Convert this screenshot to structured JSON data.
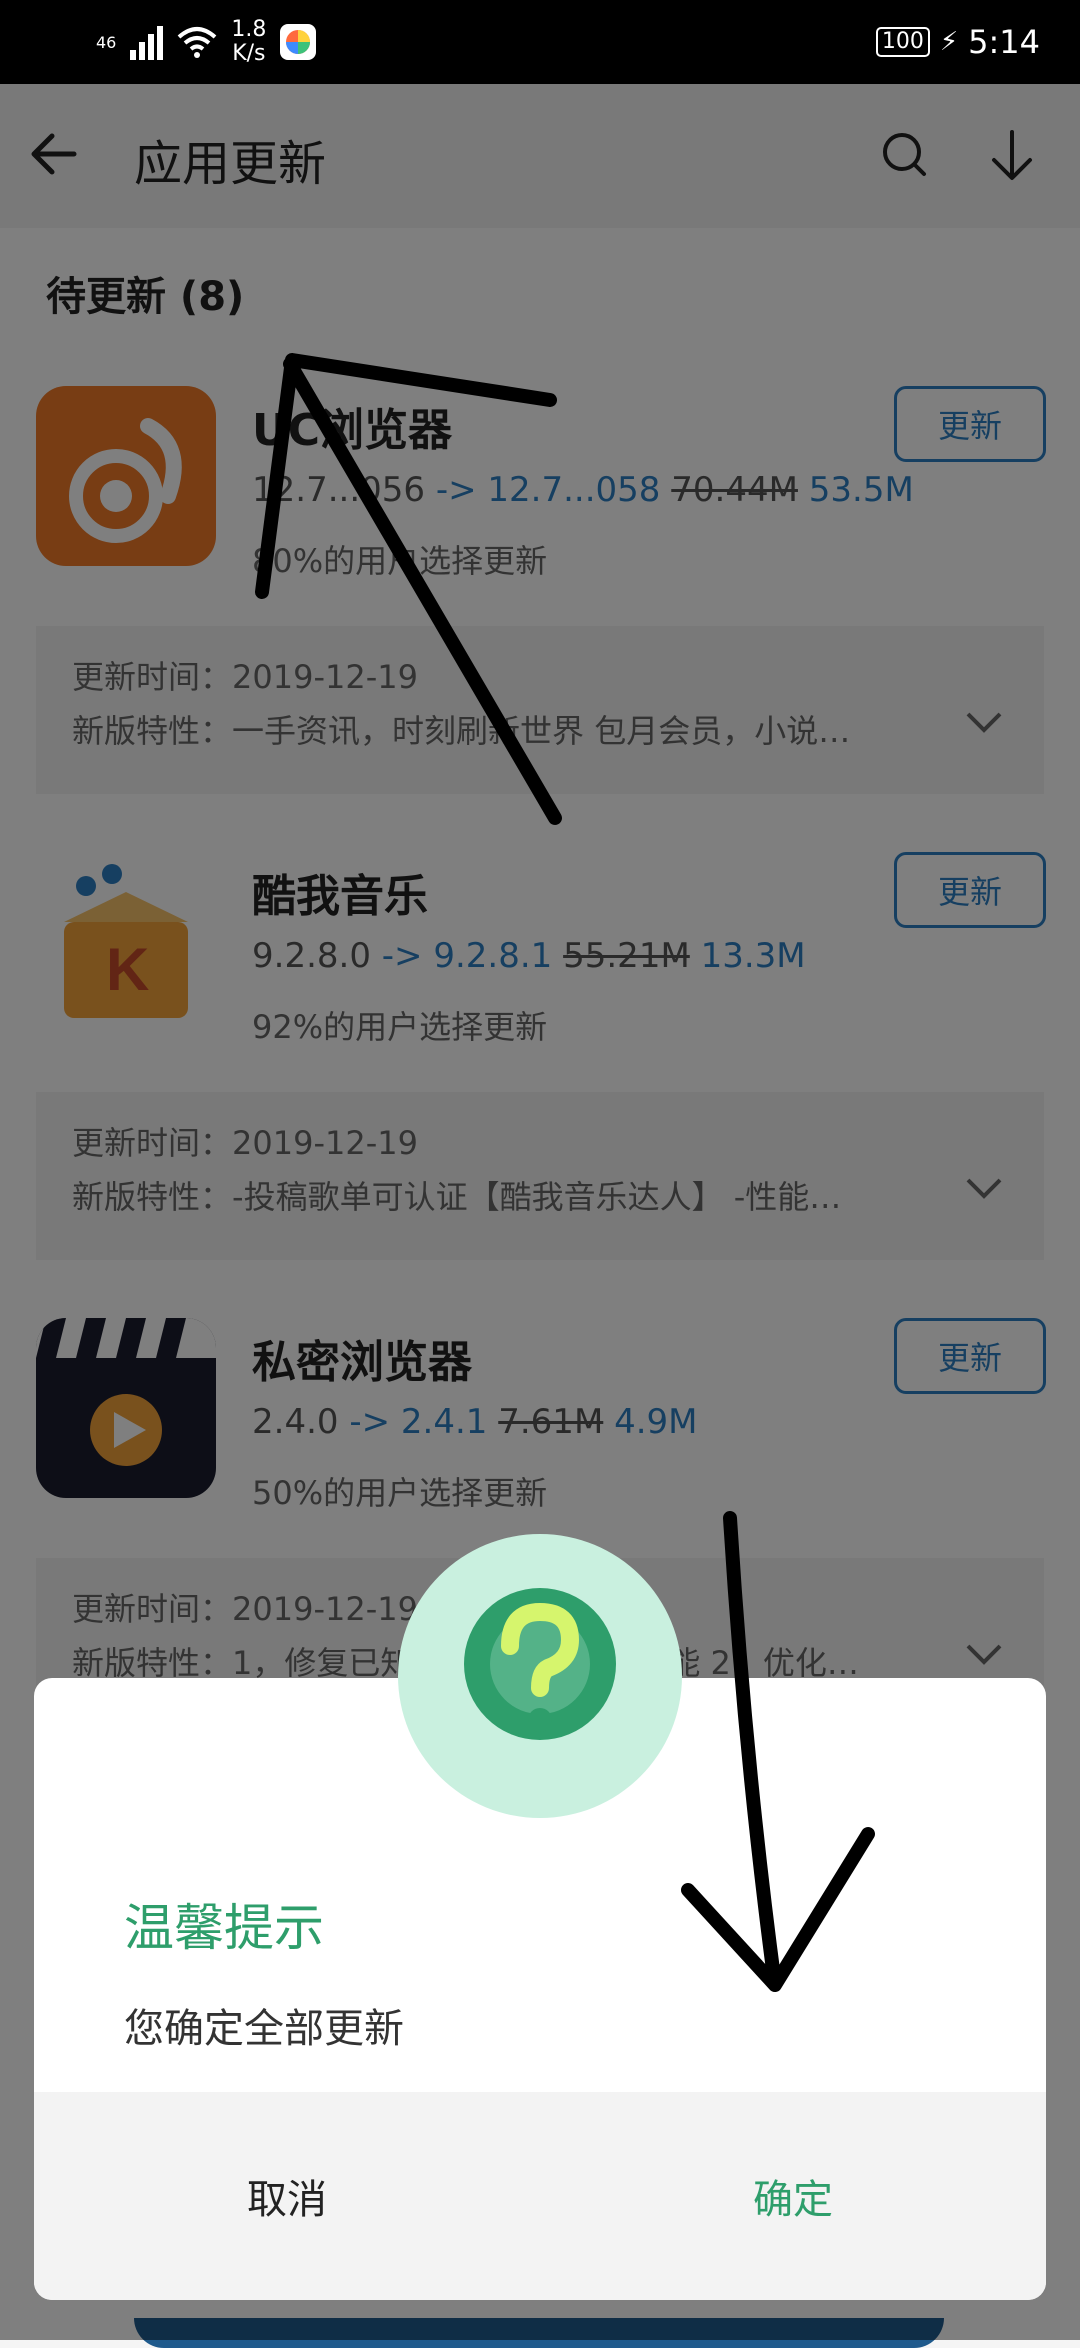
{
  "status_bar": {
    "network_type": "46",
    "speed_value": "1.8",
    "speed_unit": "K/s",
    "battery": "100",
    "time": "5:14"
  },
  "header": {
    "title": "应用更新",
    "back_icon": "back-arrow-icon",
    "search_icon": "search-icon",
    "download_icon": "download-icon"
  },
  "section": {
    "title": "待更新 (8)"
  },
  "apps": [
    {
      "name": "UC浏览器",
      "old_version": "12.7...056",
      "arrow": "->",
      "new_version": "12.7...058",
      "old_size": "70.44M",
      "new_size": "53.5M",
      "ratio": "80%的用户选择更新",
      "update_label": "更新",
      "update_time_label": "更新时间：",
      "update_time": "2019-12-19",
      "features_label": "新版特性：",
      "features": "一手资讯，时刻刷新世界 包月会员，小说…",
      "icon_color": "#f07a28"
    },
    {
      "name": "酷我音乐",
      "old_version": "9.2.8.0",
      "arrow": "->",
      "new_version": "9.2.8.1",
      "old_size": "55.21M",
      "new_size": "13.3M",
      "ratio": "92%的用户选择更新",
      "update_label": "更新",
      "update_time_label": "更新时间：",
      "update_time": "2019-12-19",
      "features_label": "新版特性：",
      "features": "-投稿歌单可认证【酷我音乐达人】 -性能…",
      "icon_color": "#f2a23a"
    },
    {
      "name": "私密浏览器",
      "old_version": "2.4.0",
      "arrow": "->",
      "new_version": "2.4.1",
      "old_size": "7.61M",
      "new_size": "4.9M",
      "ratio": "50%的用户选择更新",
      "update_label": "更新",
      "update_time_label": "更新时间：",
      "update_time": "2019-12-19",
      "features_label": "新版特性：",
      "features": "1，修复已知问题，提升使用性能 2，优化…",
      "icon_color": "#1b1d2e"
    }
  ],
  "dialog": {
    "title": "温馨提示",
    "message": "您确定全部更新",
    "cancel_label": "取消",
    "confirm_label": "确定",
    "icon": "question-icon",
    "accent_color": "#2e9e6b"
  },
  "colors": {
    "primary_blue": "#2d7fc2",
    "green": "#2e9e6b"
  }
}
